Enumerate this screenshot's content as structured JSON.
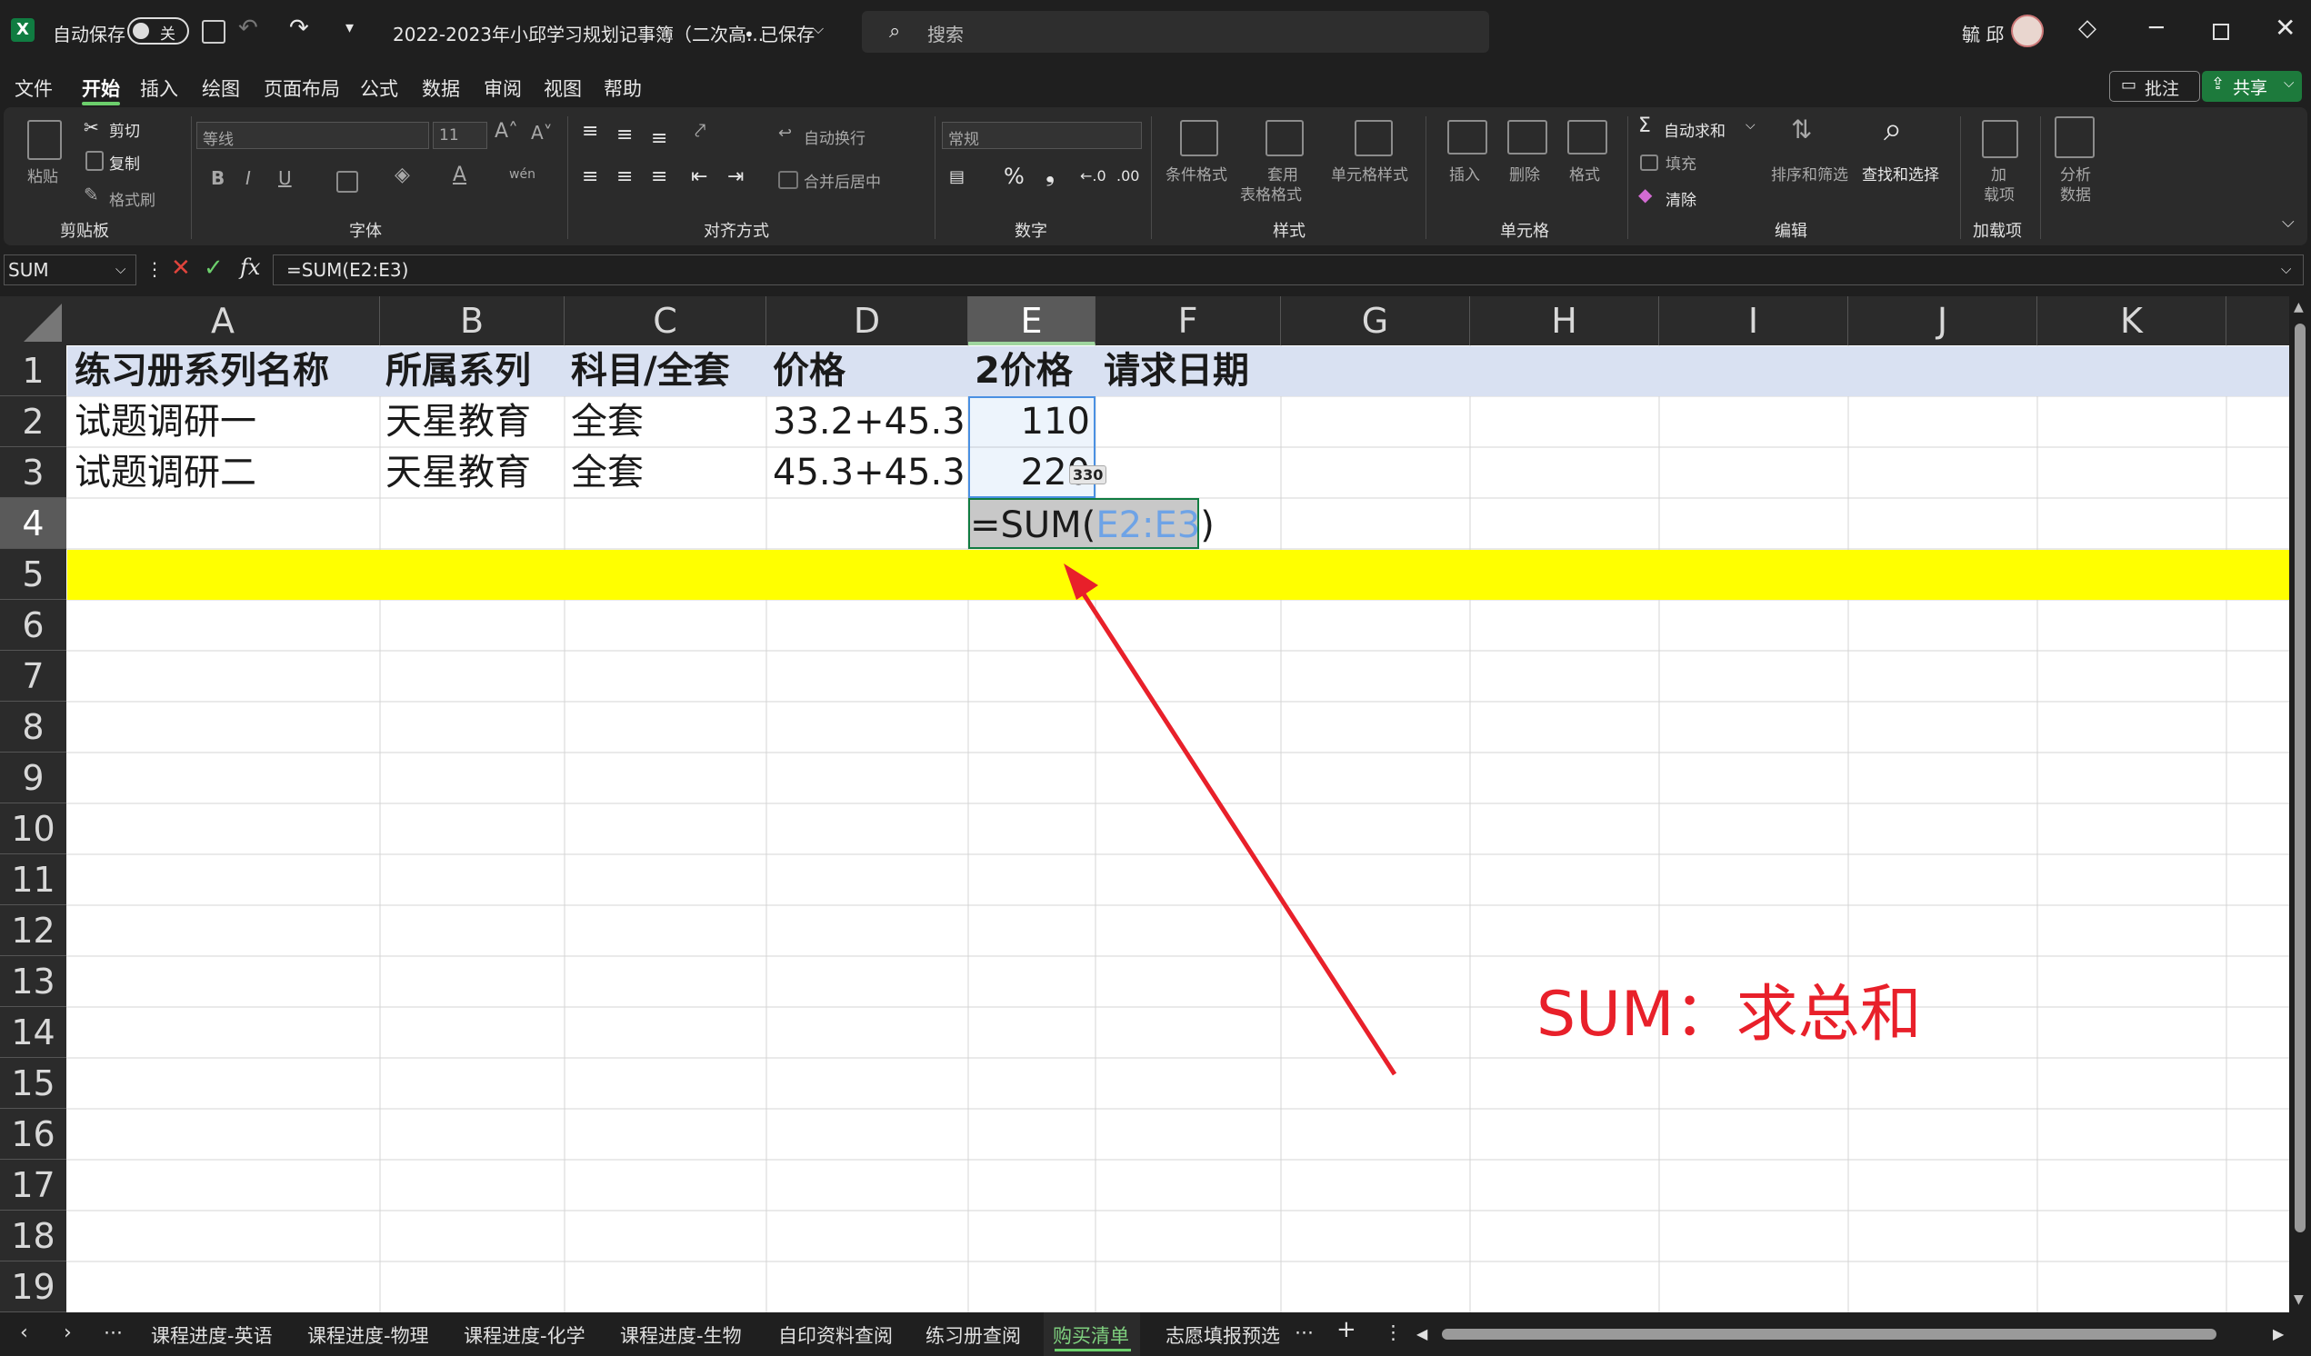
{
  "titlebar": {
    "autosave_label": "自动保存",
    "autosave_state": "关",
    "doc_title": "2022-2023年小邱学习规划记事簿（二次高...",
    "save_state": "• 已保存",
    "search_placeholder": "搜索",
    "user_name": "毓 邱"
  },
  "menu": {
    "items": [
      "文件",
      "开始",
      "插入",
      "绘图",
      "页面布局",
      "公式",
      "数据",
      "审阅",
      "视图",
      "帮助"
    ],
    "active": "开始",
    "comment_btn": "批注",
    "share_btn": "共享"
  },
  "ribbon": {
    "clipboard": {
      "paste": "粘贴",
      "cut": "剪切",
      "copy": "复制",
      "format_painter": "格式刷",
      "group": "剪贴板"
    },
    "font": {
      "font_name": "等线",
      "font_size": "11",
      "group": "字体"
    },
    "alignment": {
      "wrap": "自动换行",
      "merge": "合并后居中",
      "group": "对齐方式"
    },
    "number": {
      "format": "常规",
      "group": "数字"
    },
    "styles": {
      "conditional": "条件格式",
      "table_1": "套用",
      "table_2": "表格格式",
      "cell_styles": "单元格样式",
      "group": "样式"
    },
    "cells": {
      "insert": "插入",
      "delete": "删除",
      "format": "格式",
      "group": "单元格"
    },
    "editing": {
      "autosum": "自动求和",
      "fill": "填充",
      "clear": "清除",
      "sort": "排序和筛选",
      "find": "查找和选择",
      "group": "编辑"
    },
    "addins": {
      "addins_1": "加",
      "addins_2": "载项",
      "group": "加载项"
    },
    "analyze": {
      "label_1": "分析",
      "label_2": "数据"
    }
  },
  "formula_bar": {
    "name_box": "SUM",
    "formula": "=SUM(E2:E3)"
  },
  "grid": {
    "columns": [
      "A",
      "B",
      "C",
      "D",
      "E",
      "F",
      "G",
      "H",
      "I",
      "J",
      "K"
    ],
    "rows": [
      "1",
      "2",
      "3",
      "4",
      "5",
      "6",
      "7",
      "8",
      "9",
      "10",
      "11",
      "12",
      "13",
      "14",
      "15",
      "16",
      "17",
      "18",
      "19"
    ],
    "header_row": [
      "练习册系列名称",
      "所属系列",
      "科目/全套",
      "价格",
      "2价格",
      "请求日期"
    ],
    "row2": [
      "试题调研一",
      "天星教育",
      "全套",
      "33.2+45.3",
      "110"
    ],
    "row3": [
      "试题调研二",
      "天星教育",
      "全套",
      "45.3+45.3",
      "220"
    ],
    "edit_prefix": "=SUM(",
    "edit_ref": "E2:E3",
    "edit_suffix": ")",
    "tooltip_sum": "330"
  },
  "annotation": {
    "text": "SUM：求总和",
    "color": "#e8202a"
  },
  "sheets": {
    "tabs": [
      "课程进度-英语",
      "课程进度-物理",
      "课程进度-化学",
      "课程进度-生物",
      "自印资料查阅",
      "练习册查阅",
      "购买清单",
      "志愿填报预选"
    ],
    "active": "购买清单"
  },
  "colors": {
    "accent": "#107c41",
    "header_fill": "#d9e1f2",
    "highlight_row": "#ffff00",
    "selection_blue": "#4a90e2"
  }
}
